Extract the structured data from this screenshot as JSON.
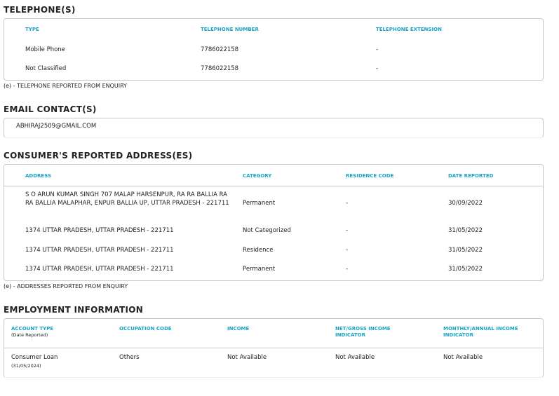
{
  "telephones": {
    "title": "TELEPHONE(S)",
    "headers": [
      "TYPE",
      "TELEPHONE NUMBER",
      "TELEPHONE EXTENSION"
    ],
    "rows": [
      [
        "Mobile Phone",
        "7786022158",
        "-"
      ],
      [
        "Not Classified",
        "7786022158",
        "-"
      ]
    ],
    "note": "(e) - TELEPHONE REPORTED FROM ENQUIRY"
  },
  "email": {
    "title": "EMAIL CONTACT(S)",
    "value": "ABHIRAJ2509@GMAIL.COM"
  },
  "addresses": {
    "title": "CONSUMER'S REPORTED ADDRESS(ES)",
    "headers": [
      "ADDRESS",
      "CATEGORY",
      "RESIDENCE CODE",
      "DATE REPORTED"
    ],
    "rows": [
      [
        "S O ARUN KUMAR SINGH 707 MALAP HARSENPUR, RA RA BALLIA RA RA BALLIA MALAPHAR, ENPUR BALLIA UP, UTTAR PRADESH - 221711",
        "Permanent",
        "-",
        "30/09/2022"
      ],
      [
        "1374 UTTAR PRADESH, UTTAR PRADESH - 221711",
        "Not Categorized",
        "-",
        "31/05/2022"
      ],
      [
        "1374 UTTAR PRADESH, UTTAR PRADESH - 221711",
        "Residence",
        "-",
        "31/05/2022"
      ],
      [
        "1374 UTTAR PRADESH, UTTAR PRADESH - 221711",
        "Permanent",
        "-",
        "31/05/2022"
      ]
    ],
    "note": "(e) - ADDRESSES REPORTED FROM ENQUIRY"
  },
  "employment": {
    "title": "EMPLOYMENT INFORMATION",
    "headers": [
      "ACCOUNT TYPE",
      "OCCUPATION CODE",
      "INCOME",
      "NET/GROSS INCOME INDICATOR",
      "MONTHLY/ANNUAL INCOME INDICATOR"
    ],
    "header_sub": "(Date Reported)",
    "row": {
      "account_type": "Consumer Loan",
      "date": "(31/05/2024)",
      "occupation": "Others",
      "income": "Not Available",
      "net_gross": "Not Available",
      "monthly_annual": "Not Available"
    }
  }
}
